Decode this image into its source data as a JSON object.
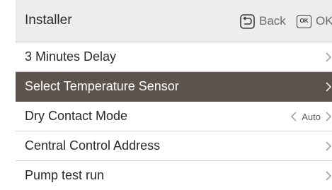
{
  "header": {
    "title": "Installer",
    "back_label": "Back",
    "ok_icon_text": "OK",
    "ok_label": "OK"
  },
  "menu": {
    "items": [
      {
        "label": "3 Minutes Delay",
        "selected": false
      },
      {
        "label": "Select Temperature Sensor",
        "selected": true
      },
      {
        "label": "Dry Contact Mode",
        "selected": false,
        "value": "Auto"
      },
      {
        "label": "Central Control Address",
        "selected": false
      },
      {
        "label": "Pump test run",
        "selected": false
      }
    ]
  },
  "colors": {
    "header_bg": "#ededed",
    "selected_bg": "#5d534d",
    "text": "#2a2a2a",
    "chevron": "#9a9a9a"
  },
  "icons": {
    "back": "back-arrow-icon",
    "ok": "ok-key-icon",
    "next": "chevron-right-icon",
    "prev": "chevron-left-icon"
  }
}
